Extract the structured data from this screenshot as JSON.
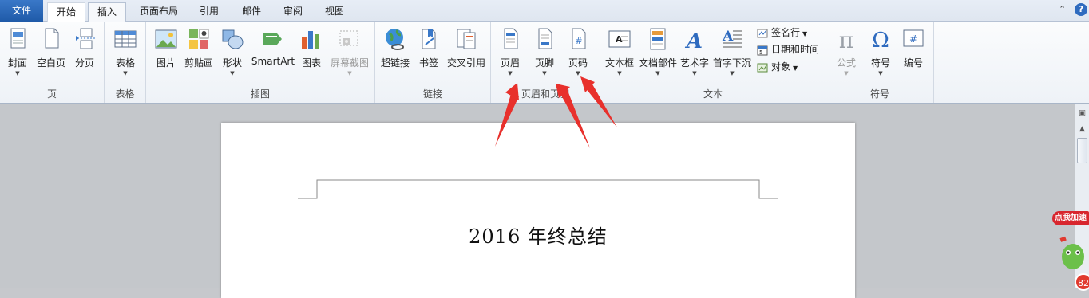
{
  "tabs": {
    "file": "文件",
    "home": "开始",
    "insert": "插入",
    "layout": "页面布局",
    "references": "引用",
    "mailings": "邮件",
    "review": "审阅",
    "view": "视图"
  },
  "help": "?",
  "groups": {
    "pages": {
      "label": "页",
      "cover": "封面",
      "blank": "空白页",
      "break": "分页"
    },
    "table": {
      "label": "表格",
      "table": "表格"
    },
    "illustrations": {
      "label": "插图",
      "picture": "图片",
      "clipart": "剪贴画",
      "shapes": "形状",
      "smartart": "SmartArt",
      "chart": "图表",
      "screenshot": "屏幕截图"
    },
    "links": {
      "label": "链接",
      "hyperlink": "超链接",
      "bookmark": "书签",
      "crossref": "交叉引用"
    },
    "headerfooter": {
      "label": "页眉和页脚",
      "header": "页眉",
      "footer": "页脚",
      "pagenum": "页码"
    },
    "text": {
      "label": "文本",
      "textbox": "文本框",
      "quickparts": "文档部件",
      "wordart": "艺术字",
      "dropcap": "首字下沉",
      "signature": "签名行",
      "datetime": "日期和时间",
      "object": "对象"
    },
    "symbols": {
      "label": "符号",
      "equation": "公式",
      "symbol": "符号",
      "number": "编号"
    }
  },
  "document": {
    "title": "2016 年终总结"
  },
  "overlay": {
    "speed_badge": "点我加速",
    "speed_count": "82"
  },
  "colors": {
    "arrow": "#e8302c",
    "file_tab": "#2a67b8"
  }
}
